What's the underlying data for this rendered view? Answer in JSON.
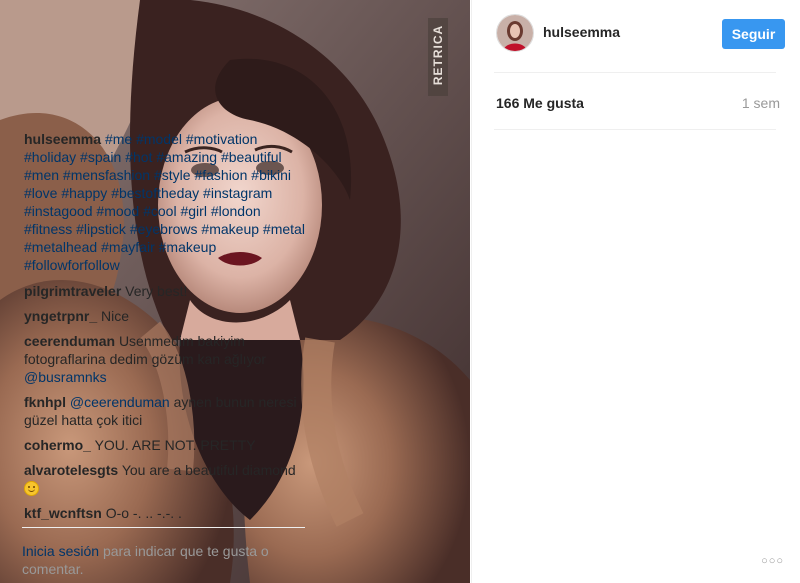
{
  "post": {
    "photo_watermark": "RETRICA",
    "colors": {
      "accent": "#3897f0",
      "link": "#003569",
      "muted": "#999999",
      "text": "#262626"
    }
  },
  "header": {
    "username": "hulseemma",
    "follow_label": "Seguir"
  },
  "meta": {
    "likes": "166 Me gusta",
    "time": "1 sem"
  },
  "caption": {
    "user": "hulseemma",
    "hashtags": [
      "#me",
      "#model",
      "#motivation",
      "#holiday",
      "#spain",
      "#hot",
      "#amazing",
      "#beautiful",
      "#men",
      "#mensfashion",
      "#style",
      "#fashion",
      "#bikini",
      "#love",
      "#happy",
      "#bestoftheday",
      "#instagram",
      "#instagood",
      "#mood",
      "#cool",
      "#girl",
      "#london",
      "#fitness",
      "#lipstick",
      "#eyebrows",
      "#makeup",
      "#metal",
      "#metalhead",
      "#mayfair",
      "#makeup",
      "#followforfollow"
    ]
  },
  "comments": [
    {
      "user": "pilgrimtraveler",
      "text": "Very best!"
    },
    {
      "user": "yngetrpnr_",
      "text": "Nice"
    },
    {
      "user": "ceerenduman",
      "text": "Usenmedim bakiyim fotograflarina dedim gözüm kan ağlıyor",
      "mention": "@busramnks"
    },
    {
      "user": "fknhpl",
      "mention": "@ceerenduman",
      "text": "aynen bunun neresi güzel hatta çok itici"
    },
    {
      "user": "cohermo_",
      "text": "YOU. ARE NOT. PRETTY"
    },
    {
      "user": "alvarotelesgts",
      "text": "You are a beautiful diamond",
      "emoji": "smiling-face"
    },
    {
      "user": "ktf_wcnftsn",
      "text": "O-o -. .. -.-. ."
    }
  ],
  "footer": {
    "login_label": "Inicia sesión",
    "rest": "para indicar que te gusta o comentar.",
    "more_label": "○○○"
  }
}
